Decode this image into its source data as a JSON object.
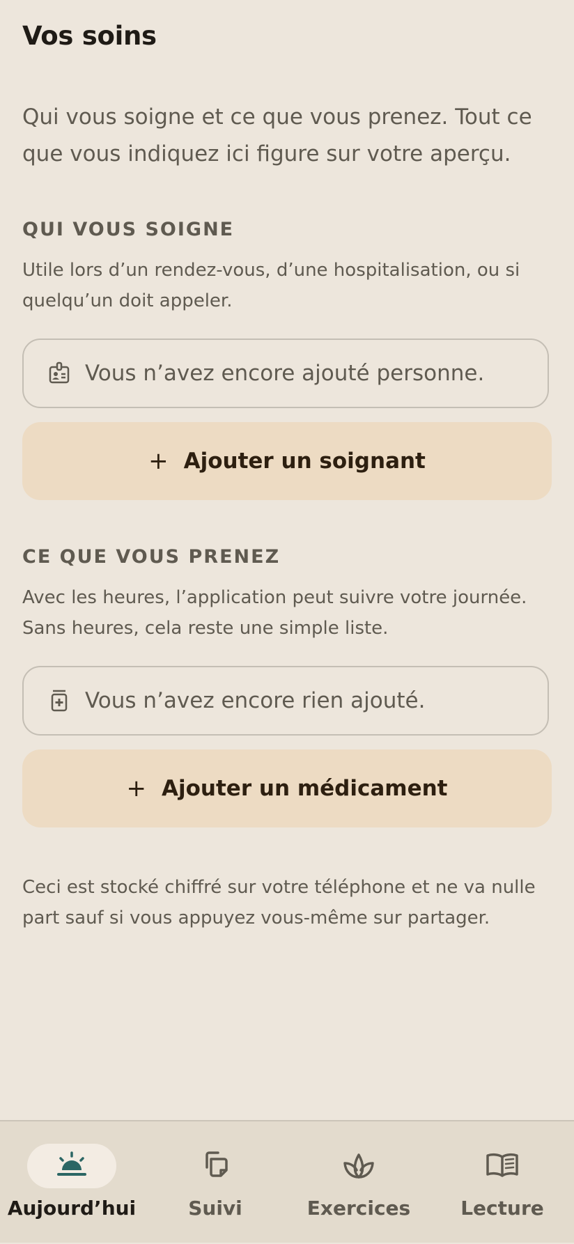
{
  "page": {
    "title": "Vos soins",
    "intro": "Qui vous soigne et ce que vous prenez. Tout ce que vous indiquez ici figure sur votre aperçu."
  },
  "caregivers": {
    "heading": "QUI VOUS SOIGNE",
    "description": "Utile lors d’un rendez-vous, d’une hospitalisation, ou si quelqu’un doit appeler.",
    "empty_text": "Vous n’avez encore ajouté personne.",
    "empty_icon": "id-badge-icon",
    "add_label": "Ajouter un soignant"
  },
  "medications": {
    "heading": "CE QUE VOUS PRENEZ",
    "description": "Avec les heures, l’application peut suivre votre journée. Sans heures, cela reste une simple liste.",
    "empty_text": "Vous n’avez encore rien ajouté.",
    "empty_icon": "pill-bottle-icon",
    "add_label": "Ajouter un médicament"
  },
  "footer_note": "Ceci est stocké chiffré sur votre téléphone et ne va nulle part sauf si vous appuyez vous-même sur partager.",
  "colors": {
    "background": "#ede6dc",
    "button": "#eddbc3",
    "accent_teal": "#2b6664",
    "nav_background": "#e3dbcd"
  },
  "bottom_nav": {
    "items": [
      {
        "label": "Aujourd’hui",
        "icon": "sunrise-icon",
        "active": true
      },
      {
        "label": "Suivi",
        "icon": "pages-icon",
        "active": false
      },
      {
        "label": "Exercices",
        "icon": "lotus-icon",
        "active": false
      },
      {
        "label": "Lecture",
        "icon": "open-book-icon",
        "active": false
      }
    ]
  }
}
